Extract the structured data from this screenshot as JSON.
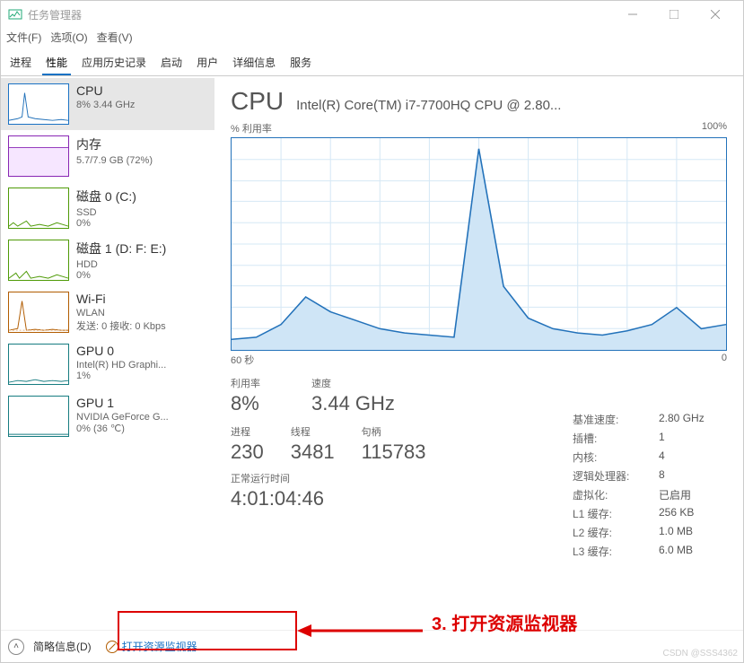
{
  "window": {
    "title": "任务管理器",
    "menu": [
      "文件(F)",
      "选项(O)",
      "查看(V)"
    ],
    "tabs": [
      "进程",
      "性能",
      "应用历史记录",
      "启动",
      "用户",
      "详细信息",
      "服务"
    ],
    "active_tab": 1
  },
  "sidebar": {
    "items": [
      {
        "title": "CPU",
        "sub": "8%  3.44 GHz",
        "type": "cpu",
        "selected": true
      },
      {
        "title": "内存",
        "sub": "5.7/7.9 GB (72%)",
        "type": "mem"
      },
      {
        "title": "磁盘 0 (C:)",
        "sub": "SSD",
        "sub2": "0%",
        "type": "disk"
      },
      {
        "title": "磁盘 1 (D: F: E:)",
        "sub": "HDD",
        "sub2": "0%",
        "type": "disk"
      },
      {
        "title": "Wi-Fi",
        "sub": "WLAN",
        "sub2": "发送: 0 接收: 0 Kbps",
        "type": "wifi"
      },
      {
        "title": "GPU 0",
        "sub": "Intel(R) HD Graphi...",
        "sub2": "1%",
        "type": "gpu"
      },
      {
        "title": "GPU 1",
        "sub": "NVIDIA GeForce G...",
        "sub2": "0% (36 ℃)",
        "type": "gpu"
      }
    ]
  },
  "detail": {
    "heading": "CPU",
    "model": "Intel(R) Core(TM) i7-7700HQ CPU @ 2.80...",
    "chart_label_left": "% 利用率",
    "chart_label_right": "100%",
    "chart_axis_left": "60 秒",
    "chart_axis_right": "0",
    "stats_top": [
      {
        "label": "利用率",
        "value": "8%"
      },
      {
        "label": "速度",
        "value": "3.44 GHz"
      }
    ],
    "stats_mid": [
      {
        "label": "进程",
        "value": "230"
      },
      {
        "label": "线程",
        "value": "3481"
      },
      {
        "label": "句柄",
        "value": "115783"
      }
    ],
    "uptime_label": "正常运行时间",
    "uptime_value": "4:01:04:46",
    "right": [
      {
        "k": "基准速度:",
        "v": "2.80 GHz"
      },
      {
        "k": "插槽:",
        "v": "1"
      },
      {
        "k": "内核:",
        "v": "4"
      },
      {
        "k": "逻辑处理器:",
        "v": "8"
      },
      {
        "k": "虚拟化:",
        "v": "已启用"
      },
      {
        "k": "L1 缓存:",
        "v": "256 KB"
      },
      {
        "k": "L2 缓存:",
        "v": "1.0 MB"
      },
      {
        "k": "L3 缓存:",
        "v": "6.0 MB"
      }
    ]
  },
  "footer": {
    "less": "简略信息(D)",
    "resmon": "打开资源监视器"
  },
  "annotation": {
    "text": "3. 打开资源监视器"
  },
  "chart_data": {
    "type": "line",
    "title": "% 利用率",
    "ylabel": "利用率 %",
    "xlabel": "秒",
    "ylim": [
      0,
      100
    ],
    "xlim": [
      60,
      0
    ],
    "x": [
      60,
      57,
      54,
      51,
      48,
      45,
      42,
      39,
      36,
      33,
      30,
      27,
      24,
      21,
      18,
      15,
      12,
      9,
      6,
      3,
      0
    ],
    "values": [
      5,
      6,
      12,
      25,
      18,
      14,
      10,
      8,
      7,
      6,
      95,
      30,
      15,
      10,
      8,
      7,
      9,
      12,
      20,
      10,
      12
    ]
  },
  "watermark": "CSDN @SSS4362"
}
